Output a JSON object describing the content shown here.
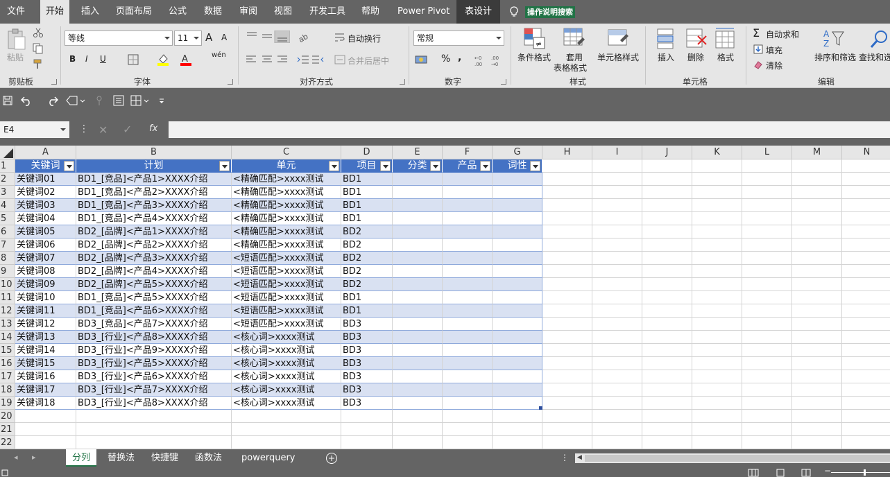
{
  "menu": {
    "items": [
      "文件",
      "开始",
      "插入",
      "页面布局",
      "公式",
      "数据",
      "审阅",
      "视图",
      "开发工具",
      "帮助",
      "Power Pivot",
      "表设计"
    ],
    "active": "开始",
    "search_hint": "操作说明搜索"
  },
  "ribbon": {
    "clipboard": {
      "paste": "粘贴",
      "label": "剪贴板"
    },
    "font": {
      "name": "等线",
      "size": "11",
      "bold": "B",
      "italic": "I",
      "underline": "U",
      "grow": "A",
      "shrink": "A",
      "wen": "wén",
      "label": "字体"
    },
    "align": {
      "wrap": "自动换行",
      "merge": "合并后居中",
      "label": "对齐方式"
    },
    "number": {
      "format": "常规",
      "percent": "%",
      "comma": ",",
      "label": "数字"
    },
    "styles": {
      "cond": "条件格式",
      "table1": "套用",
      "table2": "表格格式",
      "cell": "单元格样式",
      "label": "样式"
    },
    "cells": {
      "insert": "插入",
      "delete": "删除",
      "format": "格式",
      "label": "单元格"
    },
    "editing": {
      "autosum": "自动求和",
      "fill": "填充",
      "clear": "清除",
      "sort": "排序和筛选",
      "find": "查找和选",
      "label": "编辑"
    }
  },
  "formula_bar": {
    "name_box": "E4",
    "fx": "fx",
    "value": ""
  },
  "columns": [
    "A",
    "B",
    "C",
    "D",
    "E",
    "F",
    "G",
    "H",
    "I",
    "J",
    "K",
    "L",
    "M",
    "N"
  ],
  "row_numbers": [
    "1",
    "2",
    "3",
    "4",
    "5",
    "6",
    "7",
    "8",
    "9",
    "10",
    "11",
    "12",
    "13",
    "14",
    "15",
    "16",
    "17",
    "18",
    "19",
    "20",
    "21",
    "22"
  ],
  "table": {
    "headers": [
      "关键词",
      "计划",
      "单元",
      "项目",
      "分类",
      "产品",
      "词性"
    ],
    "rows": [
      [
        "关键词01",
        "BD1_[竞品]<产品1>XXXX介绍",
        "<精确匹配>xxxx测试",
        "BD1"
      ],
      [
        "关键词02",
        "BD1_[竞品]<产品2>XXXX介绍",
        "<精确匹配>xxxx测试",
        "BD1"
      ],
      [
        "关键词03",
        "BD1_[竞品]<产品3>XXXX介绍",
        "<精确匹配>xxxx测试",
        "BD1"
      ],
      [
        "关键词04",
        "BD1_[竞品]<产品4>XXXX介绍",
        "<精确匹配>xxxx测试",
        "BD1"
      ],
      [
        "关键词05",
        "BD2_[品牌]<产品1>XXXX介绍",
        "<精确匹配>xxxx测试",
        "BD2"
      ],
      [
        "关键词06",
        "BD2_[品牌]<产品2>XXXX介绍",
        "<精确匹配>xxxx测试",
        "BD2"
      ],
      [
        "关键词07",
        "BD2_[品牌]<产品3>XXXX介绍",
        "<短语匹配>xxxx测试",
        "BD2"
      ],
      [
        "关键词08",
        "BD2_[品牌]<产品4>XXXX介绍",
        "<短语匹配>xxxx测试",
        "BD2"
      ],
      [
        "关键词09",
        "BD2_[品牌]<产品5>XXXX介绍",
        "<短语匹配>xxxx测试",
        "BD2"
      ],
      [
        "关键词10",
        "BD1_[竞品]<产品5>XXXX介绍",
        "<短语匹配>xxxx测试",
        "BD1"
      ],
      [
        "关键词11",
        "BD1_[竞品]<产品6>XXXX介绍",
        "<短语匹配>xxxx测试",
        "BD1"
      ],
      [
        "关键词12",
        "BD3_[竞品]<产品7>XXXX介绍",
        "<短语匹配>xxxx测试",
        "BD3"
      ],
      [
        "关键词13",
        "BD3_[行业]<产品8>XXXX介绍",
        "<核心词>xxxx测试",
        "BD3"
      ],
      [
        "关键词14",
        "BD3_[行业]<产品9>XXXX介绍",
        "<核心词>xxxx测试",
        "BD3"
      ],
      [
        "关键词15",
        "BD3_[行业]<产品5>XXXX介绍",
        "<核心词>xxxx测试",
        "BD3"
      ],
      [
        "关键词16",
        "BD3_[行业]<产品6>XXXX介绍",
        "<核心词>xxxx测试",
        "BD3"
      ],
      [
        "关键词17",
        "BD3_[行业]<产品7>XXXX介绍",
        "<核心词>xxxx测试",
        "BD3"
      ],
      [
        "关键词18",
        "BD3_[行业]<产品8>XXXX介绍",
        "<核心词>xxxx测试",
        "BD3"
      ]
    ]
  },
  "sheets": [
    "分列",
    "替换法",
    "快捷键",
    "函数法",
    "powerquery"
  ],
  "active_sheet": "分列",
  "colors": {
    "accent": "#217346",
    "table_header": "#4472c4",
    "band": "#d9e1f2"
  }
}
